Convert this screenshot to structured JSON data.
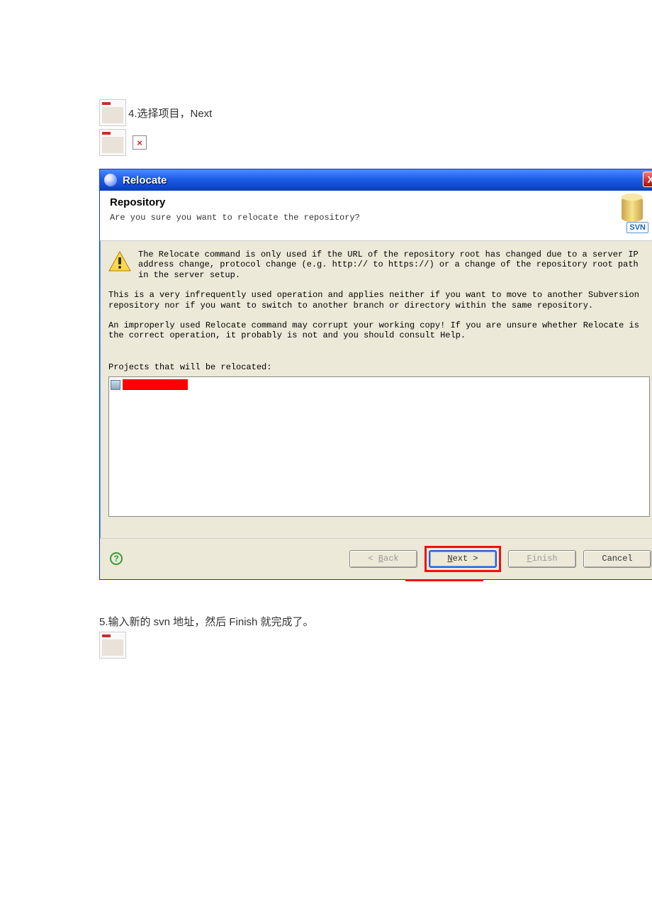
{
  "doc": {
    "step4": "4.选择项目，Next",
    "step5": "5.输入新的 svn 地址，然后 Finish 就完成了。"
  },
  "dialog": {
    "title": "Relocate",
    "header_title": "Repository",
    "header_subtitle": "Are you sure you want to relocate the repository?",
    "svn_label": "SVN",
    "warning": "The Relocate command is only used if the URL of the repository root has changed due to a server IP address change, protocol change (e.g. http:// to https://) or a change of the repository root path in the server setup.",
    "para2": "This is a very infrequently used operation and applies neither if you want to move to another Subversion repository nor if you want to switch to another branch or directory within the same repository.",
    "para3": "An improperly used Relocate command may corrupt your working copy!  If you are unsure whether Relocate is the correct operation, it probably is not and you should consult Help.",
    "projects_label": "Projects that will be relocated:",
    "buttons": {
      "back": "< Back",
      "next": "Next >",
      "finish": "Finish",
      "cancel": "Cancel"
    },
    "help_char": "?",
    "close_char": "X"
  }
}
